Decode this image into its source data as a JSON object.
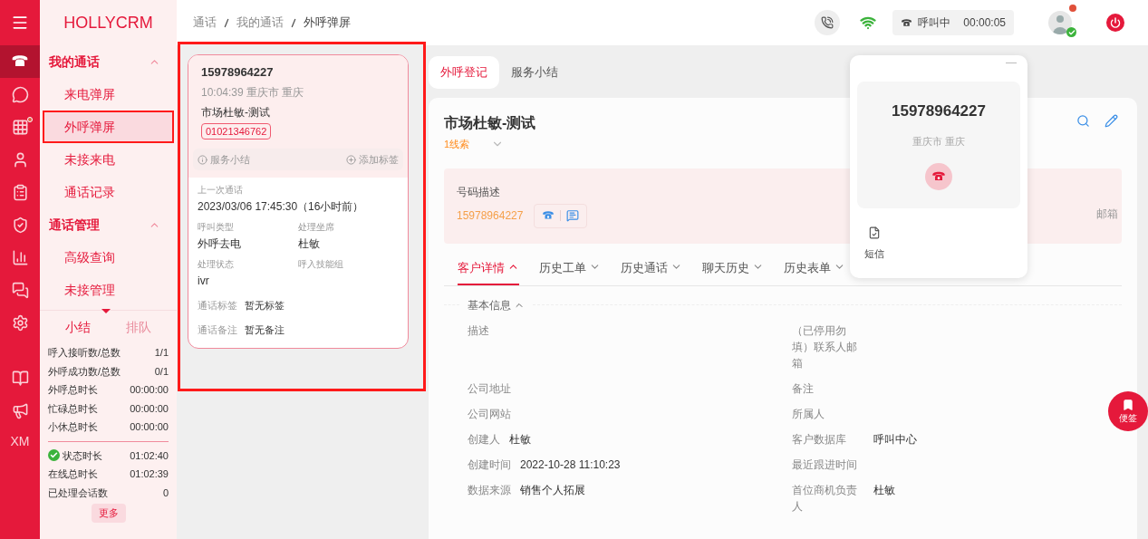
{
  "app": {
    "logo": "HOLLYCRM"
  },
  "rail": [
    {
      "selected": true,
      "dot": false
    },
    {
      "selected": false,
      "dot": false
    },
    {
      "selected": false,
      "dot": true
    },
    {
      "selected": false,
      "dot": false
    },
    {
      "selected": false,
      "dot": false
    },
    {
      "selected": false,
      "dot": false
    },
    {
      "selected": false,
      "dot": false
    },
    {
      "selected": false,
      "dot": false
    },
    {
      "selected": false,
      "dot": false
    },
    {
      "selected": false,
      "dot": false
    },
    {
      "selected": false,
      "dot": false
    }
  ],
  "rail_user": "XM",
  "sidebar": {
    "groups": [
      {
        "title": "我的通话",
        "expanded": true,
        "items": [
          {
            "label": "来电弹屏",
            "selected": false
          },
          {
            "label": "外呼弹屏",
            "selected": true
          },
          {
            "label": "未接来电",
            "selected": false
          },
          {
            "label": "通话记录",
            "selected": false
          }
        ]
      },
      {
        "title": "通话管理",
        "expanded": true,
        "items": [
          {
            "label": "高级查询",
            "selected": false
          },
          {
            "label": "未接管理",
            "selected": false
          }
        ]
      }
    ]
  },
  "summary": {
    "tabs": [
      {
        "label": "小结",
        "selected": true
      },
      {
        "label": "排队",
        "selected": false
      }
    ],
    "stats": [
      {
        "label": "呼入接听数/总数",
        "value": "1/1"
      },
      {
        "label": "外呼成功数/总数",
        "value": "0/1"
      },
      {
        "label": "外呼总时长",
        "value": "00:00:00"
      },
      {
        "label": "忙碌总时长",
        "value": "00:00:00"
      },
      {
        "label": "小休总时长",
        "value": "00:00:00"
      }
    ],
    "status": [
      {
        "label": "状态时长",
        "value": "01:02:40",
        "ok": true
      },
      {
        "label": "在线总时长",
        "value": "01:02:39",
        "ok": false
      },
      {
        "label": "已处理会话数",
        "value": "0",
        "ok": false
      }
    ],
    "more": "更多"
  },
  "breadcrumb": [
    "通话",
    "我的通话",
    "外呼弹屏"
  ],
  "topbar": {
    "call_state": "呼叫中",
    "timer": "00:00:05"
  },
  "call_card": {
    "number": "15978964227",
    "time_location": "10:04:39 重庆市 重庆",
    "name": "市场杜敏-测试",
    "tag": "01021346762",
    "summary_action": "服务小结",
    "tag_action": "添加标签",
    "last_call_label": "上一次通话",
    "last_call": "2023/03/06 17:45:30（16小时前）",
    "fields": [
      {
        "label": "呼叫类型",
        "value": "外呼去电"
      },
      {
        "label": "处理坐席",
        "value": "杜敏"
      },
      {
        "label": "处理状态",
        "value": "ivr"
      },
      {
        "label": "呼入技能组"
      }
    ],
    "notes": [
      {
        "label": "通话标签",
        "value": "暂无标签"
      },
      {
        "label": "通话备注",
        "value": "暂无备注"
      }
    ]
  },
  "main_tabs": [
    {
      "label": "外呼登记",
      "selected": true
    },
    {
      "label": "服务小结",
      "selected": false
    }
  ],
  "customer": {
    "name": "市场杜敏-测试",
    "clue": "1线索",
    "number_label": "号码描述",
    "number": "15978964227",
    "email_label": "邮箱",
    "tabs": [
      {
        "label": "客户详情",
        "selected": true
      },
      {
        "label": "历史工单",
        "selected": false
      },
      {
        "label": "历史通话",
        "selected": false
      },
      {
        "label": "聊天历史",
        "selected": false
      },
      {
        "label": "历史表单",
        "selected": false
      }
    ],
    "section": "基本信息",
    "fields": [
      {
        "label": "描述"
      },
      {
        "label": "（已停用勿填）联系人邮箱"
      },
      {
        "label": "公司地址"
      },
      {
        "label": "备注"
      },
      {
        "label": "公司网站"
      },
      {
        "label": "所属人"
      },
      {
        "label": "创建人",
        "value": "杜敏"
      },
      {
        "label": "客户数据库",
        "value": "呼叫中心"
      },
      {
        "label": "创建时间",
        "value": "2022-10-28 11:10:23"
      },
      {
        "label": "最近跟进时间"
      },
      {
        "label": "数据来源",
        "value": "销售个人拓展"
      },
      {
        "label": "首位商机负责人",
        "value": "杜敏"
      }
    ]
  },
  "popup": {
    "number": "15978964227",
    "location": "重庆市 重庆",
    "sms": "短信"
  },
  "sticky": "便签"
}
